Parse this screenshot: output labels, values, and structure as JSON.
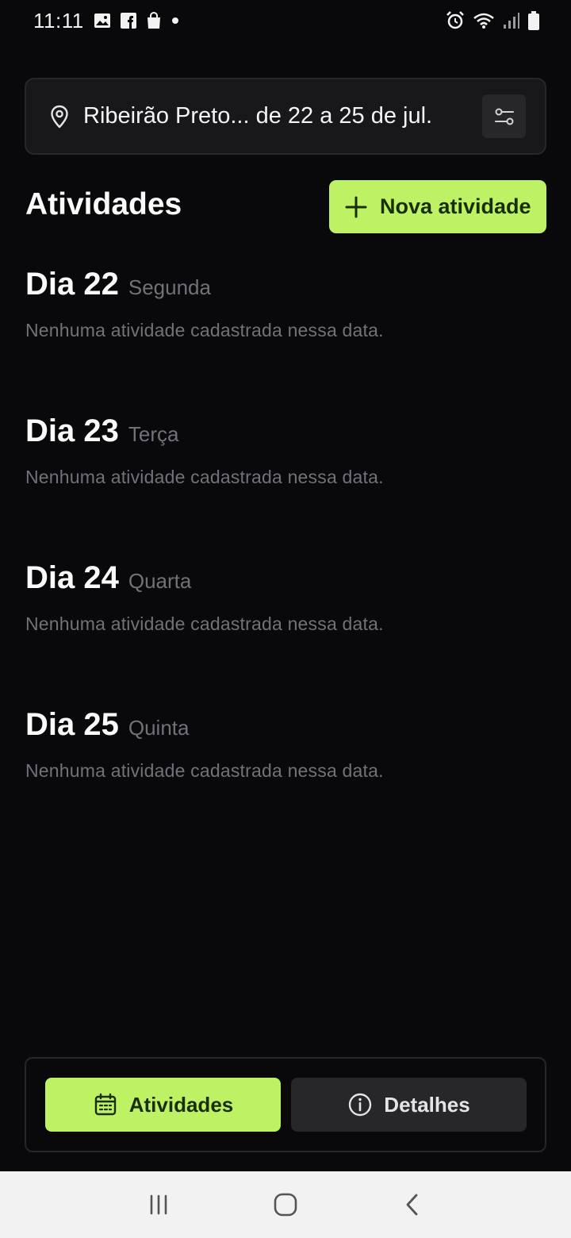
{
  "status_bar": {
    "time": "11:11",
    "icons_left": [
      "image-icon",
      "facebook-icon",
      "shopping-bag-icon",
      "dot-icon"
    ],
    "icons_right": [
      "alarm-icon",
      "wifi-icon",
      "signal-icon",
      "battery-icon"
    ]
  },
  "header": {
    "trip_summary": "Ribeirão Preto... de 22 a 25 de jul."
  },
  "activities": {
    "title": "Atividades",
    "new_button_label": "Nova atividade"
  },
  "days": [
    {
      "title": "Dia 22",
      "weekday": "Segunda",
      "empty_text": "Nenhuma atividade cadastrada nessa data."
    },
    {
      "title": "Dia 23",
      "weekday": "Terça",
      "empty_text": "Nenhuma atividade cadastrada nessa data."
    },
    {
      "title": "Dia 24",
      "weekday": "Quarta",
      "empty_text": "Nenhuma atividade cadastrada nessa data."
    },
    {
      "title": "Dia 25",
      "weekday": "Quinta",
      "empty_text": "Nenhuma atividade cadastrada nessa data."
    }
  ],
  "tabs": [
    {
      "label": "Atividades",
      "icon": "calendar-icon",
      "active": true
    },
    {
      "label": "Detalhes",
      "icon": "info-icon",
      "active": false
    }
  ],
  "colors": {
    "background": "#09090b",
    "accent": "#bef264",
    "card": "#18181b",
    "muted_text": "#71717a"
  }
}
